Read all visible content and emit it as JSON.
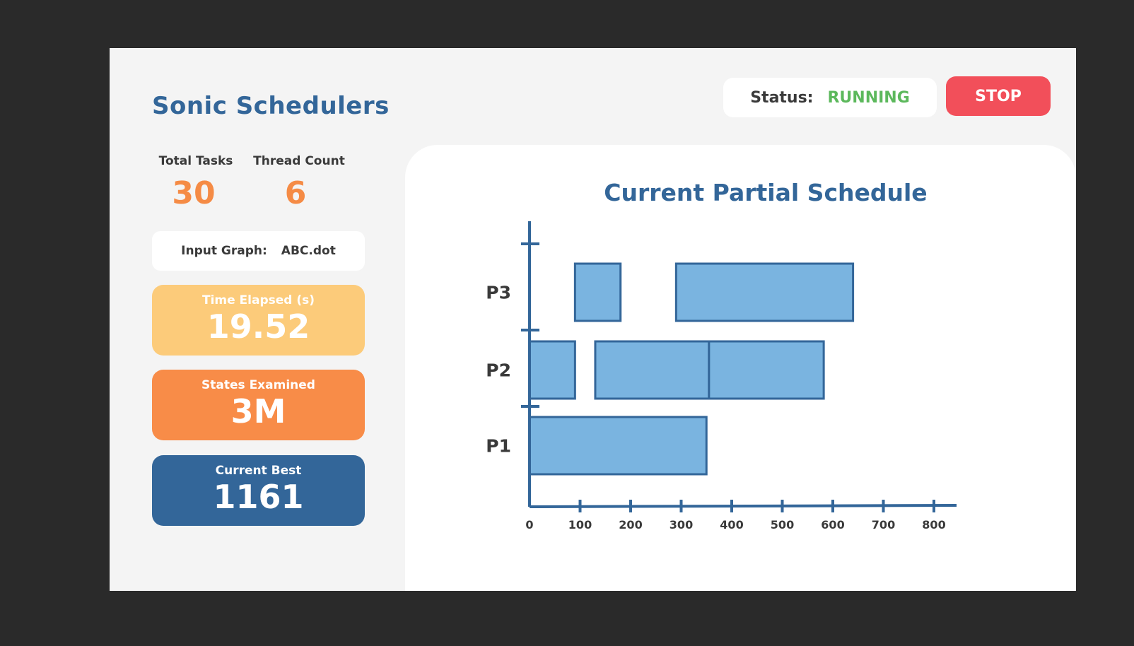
{
  "app": {
    "title": "Sonic Schedulers"
  },
  "stats": {
    "total_tasks_label": "Total Tasks",
    "total_tasks_value": "30",
    "thread_count_label": "Thread Count",
    "thread_count_value": "6"
  },
  "input_graph": {
    "label": "Input Graph:",
    "value": "ABC.dot"
  },
  "cards": {
    "time_label": "Time Elapsed (s)",
    "time_value": "19.52",
    "states_label": "States Examined",
    "states_value": "3M",
    "best_label": "Current Best",
    "best_value": "1161"
  },
  "status": {
    "label": "Status:",
    "value": "RUNNING"
  },
  "controls": {
    "stop_label": "STOP"
  },
  "colors": {
    "brand": "#336699",
    "accent_orange": "#f58b45",
    "card_yellow": "#fccb7a",
    "running_green": "#5cb85c",
    "stop_red": "#f24f5a",
    "bar_fill": "#7ab4e0"
  },
  "chart_data": {
    "type": "gantt",
    "title": "Current Partial Schedule",
    "processors": [
      "P3",
      "P2",
      "P1"
    ],
    "xlim": [
      0,
      800
    ],
    "xticks": [
      0,
      100,
      200,
      300,
      400,
      500,
      600,
      700,
      800
    ],
    "tasks": [
      {
        "processor": "P3",
        "start": 90,
        "end": 180
      },
      {
        "processor": "P3",
        "start": 290,
        "end": 640
      },
      {
        "processor": "P2",
        "start": 0,
        "end": 90
      },
      {
        "processor": "P2",
        "start": 130,
        "end": 355
      },
      {
        "processor": "P2",
        "start": 355,
        "end": 582
      },
      {
        "processor": "P1",
        "start": 0,
        "end": 350
      }
    ]
  }
}
